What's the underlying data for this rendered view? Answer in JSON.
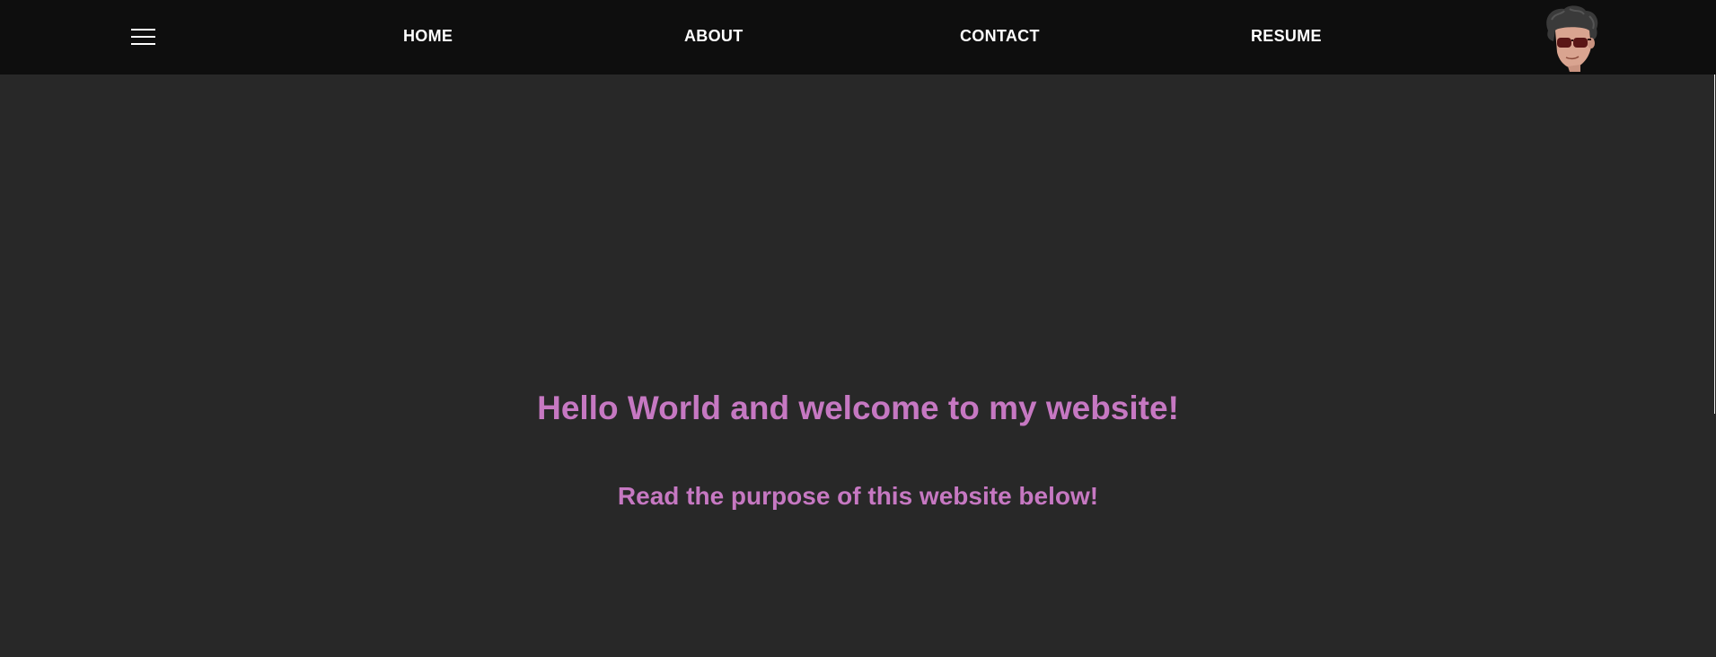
{
  "navbar": {
    "menu_icon": "hamburger-menu-icon",
    "links": [
      {
        "label": "HOME"
      },
      {
        "label": "ABOUT"
      },
      {
        "label": "CONTACT"
      },
      {
        "label": "RESUME"
      }
    ],
    "avatar_icon": "cartoon-avatar-with-sunglasses"
  },
  "hero": {
    "title": "Hello World and welcome to my website!",
    "subtitle": "Read the purpose of this website below!"
  },
  "colors": {
    "page_background": "#282828",
    "navbar_background": "#0e0e0e",
    "nav_text": "#ffffff",
    "accent_text": "#c678c2"
  }
}
